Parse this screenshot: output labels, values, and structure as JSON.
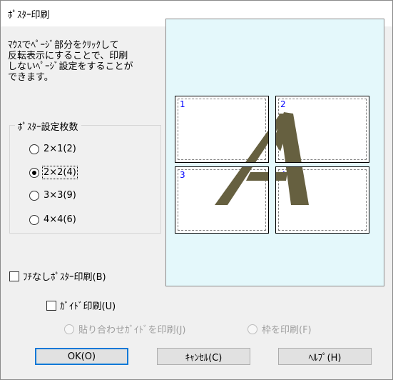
{
  "window": {
    "title": "ﾎﾟｽﾀｰ印刷"
  },
  "description": "ﾏｳｽでﾍﾟｰｼﾞ部分をｸﾘｯｸして\n反転表示にすることで、印刷\nしないﾍﾟｰｼﾞ設定をすることが\nできます。",
  "poster_count": {
    "title": "ﾎﾟｽﾀｰ設定枚数",
    "options": [
      {
        "label": "2×1(2)",
        "checked": false
      },
      {
        "label": "2×2(4)",
        "checked": true
      },
      {
        "label": "3×3(9)",
        "checked": false
      },
      {
        "label": "4×4(6)",
        "checked": false
      }
    ]
  },
  "borderless_poster": {
    "label": "ﾌﾁなしﾎﾟｽﾀｰ印刷(B)",
    "checked": false
  },
  "guide_print": {
    "label": "ｶﾞｲﾄﾞ印刷(U)",
    "checked": false
  },
  "guide_options": [
    {
      "label": "貼り合わせｶﾞｲﾄﾞを印刷(J)",
      "enabled": false
    },
    {
      "label": "枠を印刷(F)",
      "enabled": false
    }
  ],
  "preview": {
    "pages": [
      {
        "num": "1"
      },
      {
        "num": "2"
      },
      {
        "num": "3"
      },
      {
        "num": "4"
      }
    ],
    "artwork": "letter-a-graphic"
  },
  "buttons": {
    "ok": "OK(O)",
    "cancel": "ｷｬﾝｾﾙ(C)",
    "help": "ﾍﾙﾌﾟ(H)"
  },
  "colors": {
    "preview_bg": "#e4f8fb",
    "page_number": "#0000ff",
    "artwork": "#666040",
    "default_button_border": "#0078d7"
  }
}
